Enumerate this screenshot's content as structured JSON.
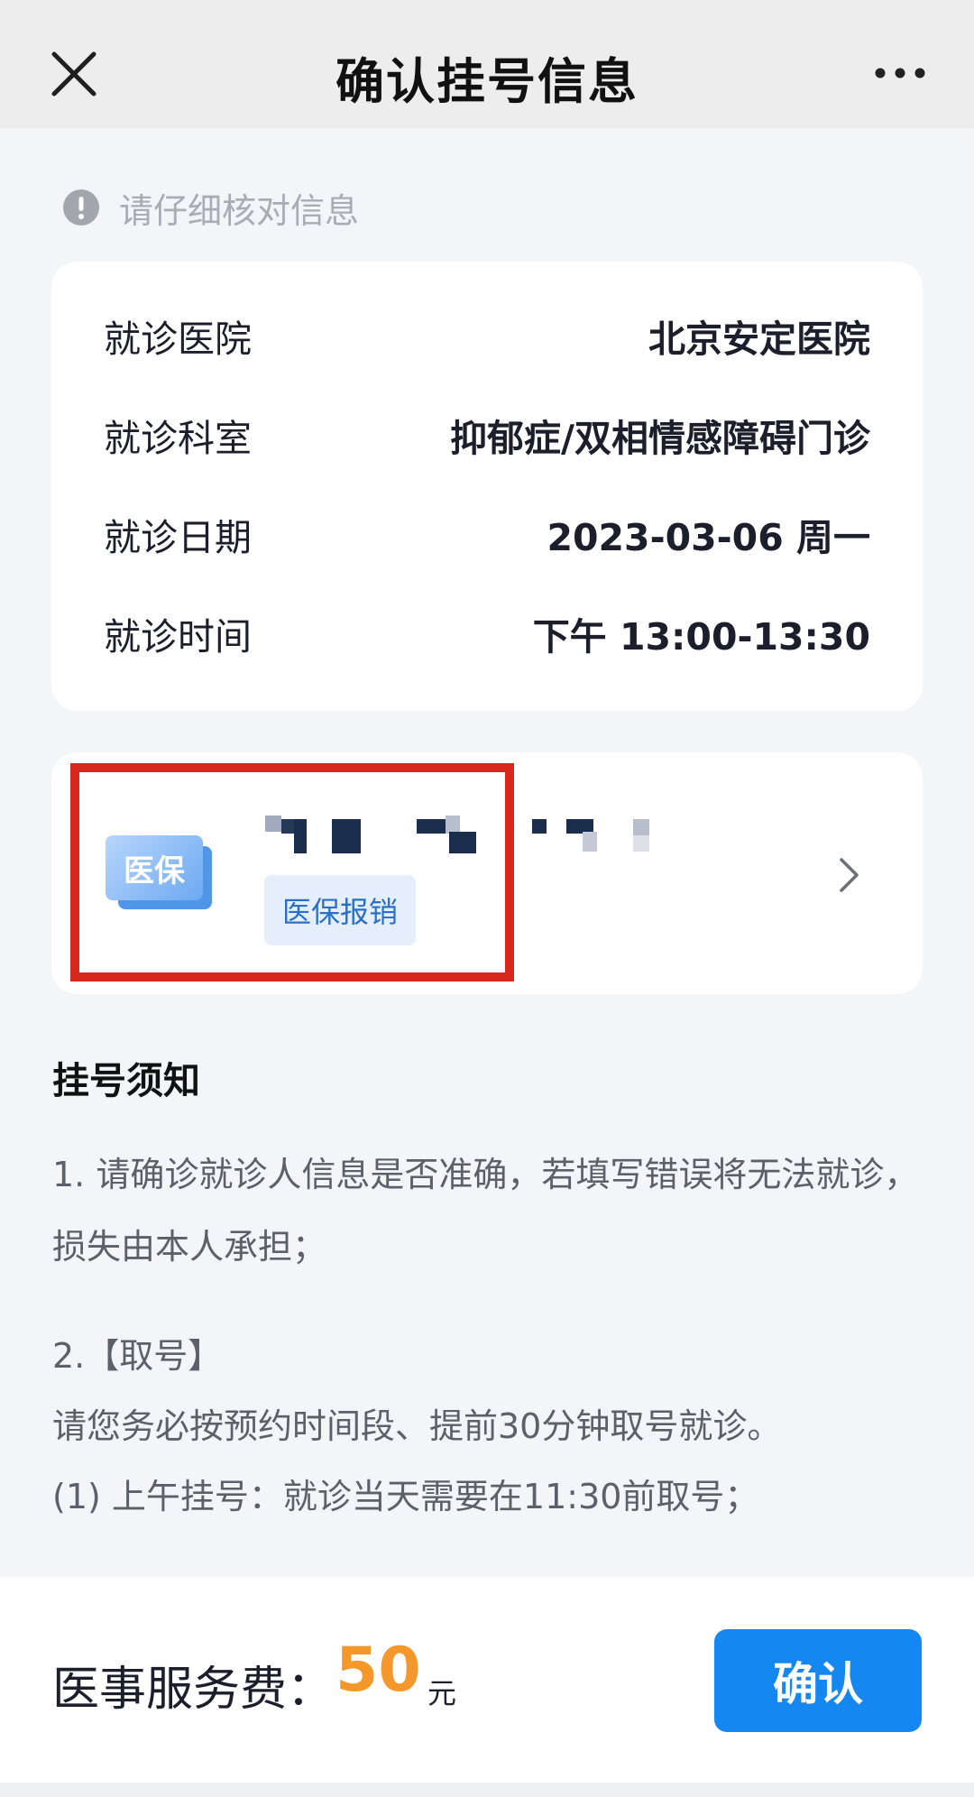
{
  "nav": {
    "title": "确认挂号信息",
    "close_icon": "close-icon",
    "more_icon": "more-icon"
  },
  "notice": {
    "icon": "exclamation-icon",
    "text": "请仔细核对信息"
  },
  "info": {
    "rows": [
      {
        "label": "就诊医院",
        "value": "北京安定医院"
      },
      {
        "label": "就诊科室",
        "value": "抑郁症/双相情感障碍门诊"
      },
      {
        "label": "就诊日期",
        "value": "2023-03-06 周一"
      },
      {
        "label": "就诊时间",
        "value": "下午 13:00-13:30"
      }
    ]
  },
  "insurance": {
    "logo_text": "医保",
    "tag": "医保报销",
    "highlight_color": "#d8271c"
  },
  "rules": {
    "title": "挂号须知",
    "rule1": "1. 请确诊就诊人信息是否准确，若填写错误将无法就诊，损失由本人承担；",
    "rule2_title": "2.【取号】",
    "rule2_line1": "请您务必按预约时间段、提前30分钟取号就诊。",
    "rule2_line2": "(1) 上午挂号：就诊当天需要在11:30前取号；"
  },
  "footer": {
    "fee_label": "医事服务费：",
    "fee_amount": "50",
    "fee_unit": "元",
    "confirm_label": "确认"
  },
  "colors": {
    "accent": "#1487f0",
    "fee": "#f4982b",
    "background": "#f3f5f8"
  }
}
